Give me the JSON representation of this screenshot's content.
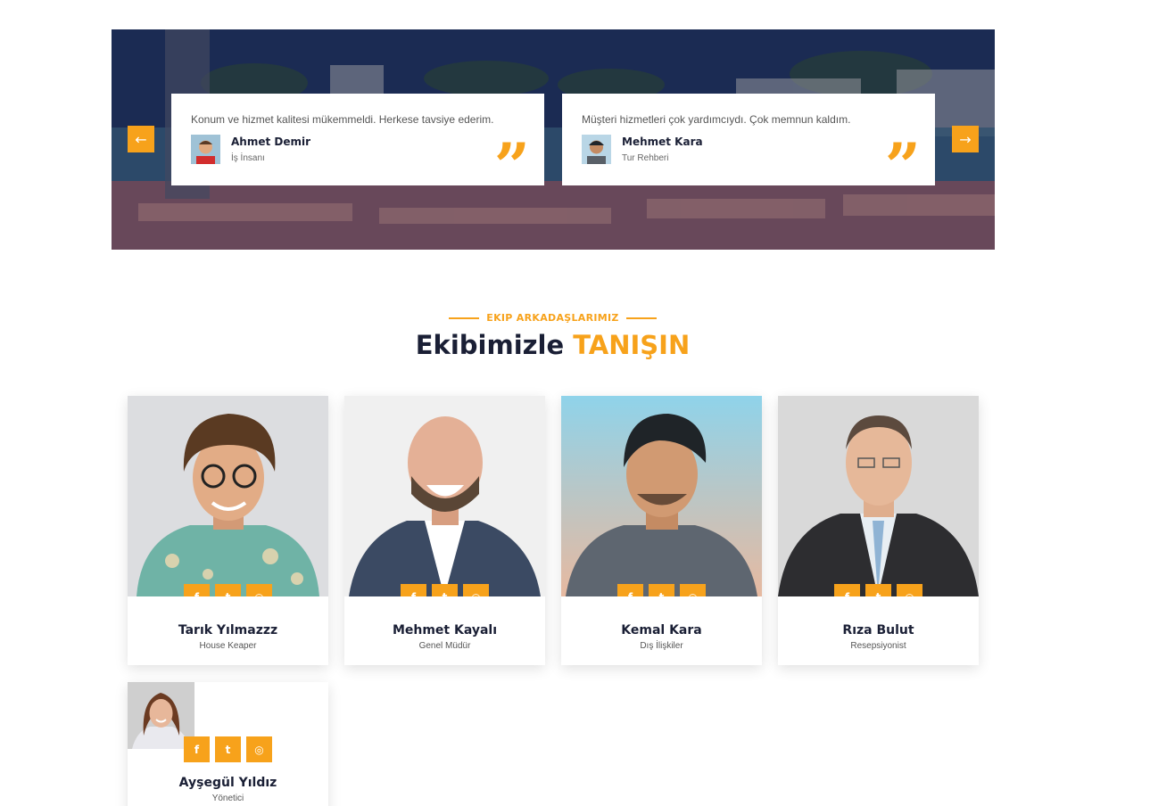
{
  "testimonials": {
    "items": [
      {
        "text": "Konum ve hizmet kalitesi mükemmeldi. Herkese tavsiye ederim.",
        "name": "Ahmet Demir",
        "role": "İş İnsanı"
      },
      {
        "text": "Müşteri hizmetleri çok yardımcıydı. Çok memnun kaldım.",
        "name": "Mehmet Kara",
        "role": "Tur Rehberi"
      }
    ],
    "prev_icon": "arrow-left-icon",
    "next_icon": "arrow-right-icon",
    "quote_icon": "quote-icon"
  },
  "team": {
    "subtitle": "EKIP ARKADAŞLARIMIZ",
    "title_main": "Ekibimizle",
    "title_accent": "TANIŞIN",
    "members": [
      {
        "name": "Tarık Yılmazzz",
        "role": "House Keaper"
      },
      {
        "name": "Mehmet Kayalı",
        "role": "Genel Müdür"
      },
      {
        "name": "Kemal Kara",
        "role": "Dış İlişkiler"
      },
      {
        "name": "Rıza Bulut",
        "role": "Resepsiyonist"
      },
      {
        "name": "Ayşegül Yıldız",
        "role": "Yönetici"
      }
    ],
    "social_icons": [
      "facebook-icon",
      "twitter-icon",
      "instagram-icon"
    ]
  },
  "colors": {
    "accent": "#f7a21b",
    "heading": "#1a1f35"
  }
}
